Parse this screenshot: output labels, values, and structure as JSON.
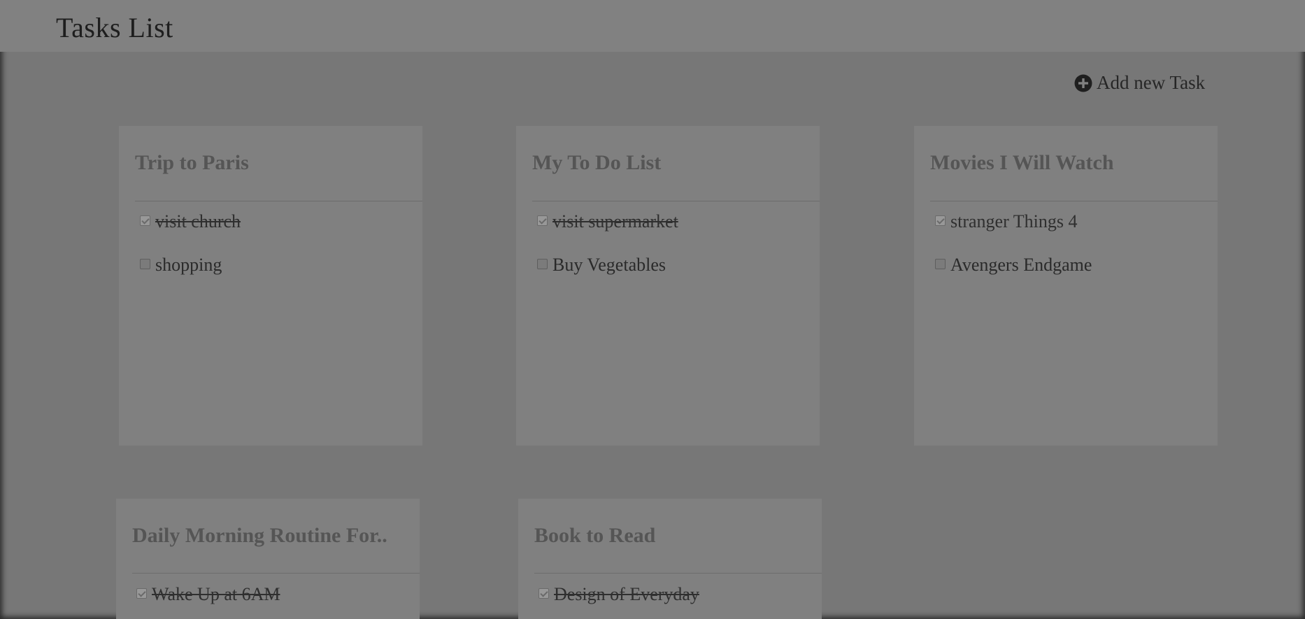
{
  "header": {
    "title": "Tasks List"
  },
  "toolbar": {
    "add_label": "Add new Task",
    "add_icon": "plus-circle-icon"
  },
  "cards": [
    {
      "title": "Trip to Paris",
      "tasks": [
        {
          "label": "visit church",
          "done": true
        },
        {
          "label": "shopping",
          "done": false
        }
      ]
    },
    {
      "title": "My To Do List",
      "tasks": [
        {
          "label": "visit supermarket",
          "done": true
        },
        {
          "label": "Buy Vegetables",
          "done": false
        }
      ]
    },
    {
      "title": "Movies I Will Watch",
      "tasks": [
        {
          "label": "stranger Things 4",
          "done": true
        },
        {
          "label": "Avengers Endgame",
          "done": false
        }
      ]
    },
    {
      "title": "Daily Morning Routine For..",
      "tasks": [
        {
          "label": "Wake Up at 6AM",
          "done": true
        }
      ]
    },
    {
      "title": "Book to Read",
      "tasks": [
        {
          "label": "Design of Everyday",
          "done": true
        }
      ]
    }
  ]
}
